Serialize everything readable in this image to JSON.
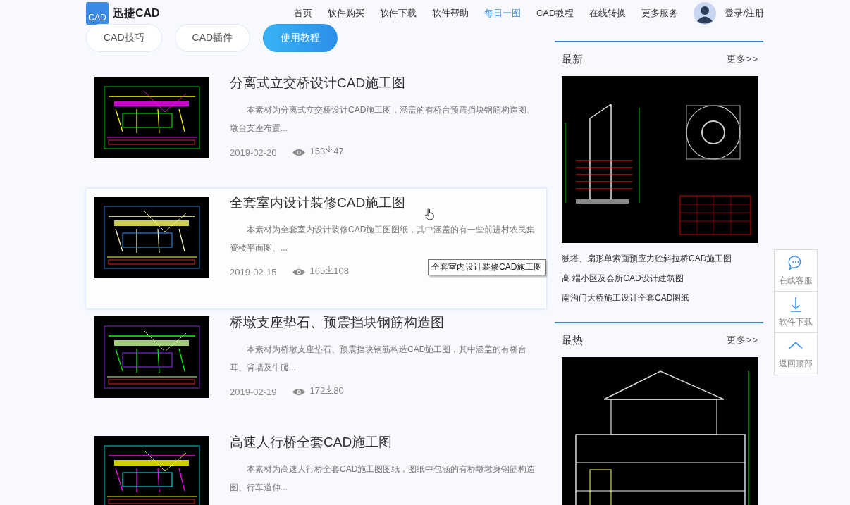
{
  "header": {
    "logo_badge": "CAD",
    "logo_text": "迅捷CAD",
    "nav": [
      {
        "label": "首页",
        "selected": false
      },
      {
        "label": "软件购买",
        "selected": false
      },
      {
        "label": "软件下载",
        "selected": false
      },
      {
        "label": "软件帮助",
        "selected": false
      },
      {
        "label": "每日一图",
        "selected": true
      },
      {
        "label": "CAD教程",
        "selected": false
      },
      {
        "label": "在线转换",
        "selected": false
      },
      {
        "label": "更多服务",
        "selected": false
      }
    ],
    "login": "登录/注册"
  },
  "tabs": [
    {
      "label": "CAD技巧",
      "selected": false
    },
    {
      "label": "CAD插件",
      "selected": false
    },
    {
      "label": "使用教程",
      "selected": true
    }
  ],
  "articles": [
    {
      "title": "分离式立交桥设计CAD施工图",
      "summary": "本素材为分离式立交桥设计CAD施工图，涵盖的有桥台预震挡块钢筋构造图、墩台支座布置...",
      "date": "2019-02-20",
      "views": "153",
      "downloads": "47",
      "highlighted": false
    },
    {
      "title": "全套室内设计装修CAD施工图",
      "summary": "本素材为全套室内设计装修CAD施工图图纸，其中涵盖的有一些前进村农民集资楼平面图、...",
      "date": "2019-02-15",
      "views": "165",
      "downloads": "108",
      "highlighted": true,
      "tooltip": "全套室内设计装修CAD施工图"
    },
    {
      "title": "桥墩支座垫石、预震挡块钢筋构造图",
      "summary": "本素材为桥墩支座垫石、预震挡块钢筋构造CAD施工图，其中涵盖的有桥台耳、背墙及牛腿...",
      "date": "2019-02-19",
      "views": "172",
      "downloads": "80",
      "highlighted": false
    },
    {
      "title": "高速人行桥全套CAD施工图",
      "summary": "本素材为高速人行桥全套CAD施工图图纸，图纸中包涵的有桥墩墩身钢筋构造图、行车道伸...",
      "highlighted": false
    }
  ],
  "sidebar": [
    {
      "title": "最新",
      "more": "更多>>",
      "items": [
        "独塔、扇形单索面预应力砼斜拉桥CAD施工图",
        "高 端小区及会所CAD设计建筑图",
        "南沟门大桥施工设计全套CAD图纸"
      ]
    },
    {
      "title": "最热",
      "more": "更多>>"
    }
  ],
  "float_tools": [
    {
      "kind": "chat",
      "label": "在线客服"
    },
    {
      "kind": "download",
      "label": "软件下载"
    },
    {
      "kind": "top",
      "label": "返回顶部"
    }
  ]
}
